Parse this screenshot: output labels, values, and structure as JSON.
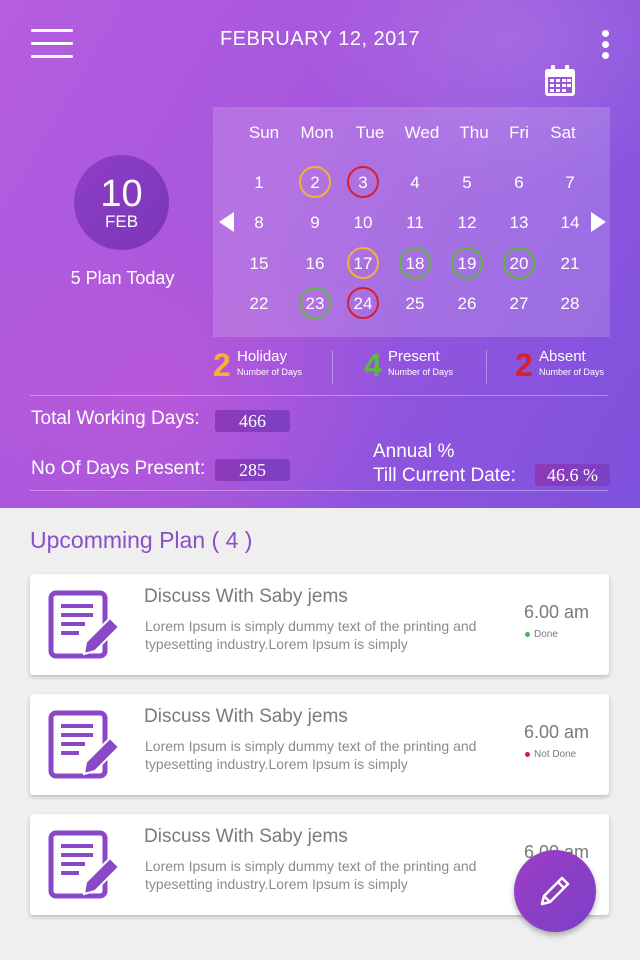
{
  "header": {
    "date_title": "FEBRUARY 12, 2017"
  },
  "selected": {
    "day": "10",
    "month": "FEB",
    "plan_text": "5 Plan Today"
  },
  "calendar": {
    "weekdays": [
      "Sun",
      "Mon",
      "Tue",
      "Wed",
      "Thu",
      "Fri",
      "Sat"
    ],
    "weeks": [
      [
        "1",
        "2",
        "3",
        "4",
        "5",
        "6",
        "7"
      ],
      [
        "8",
        "9",
        "10",
        "11",
        "12",
        "13",
        "14"
      ],
      [
        "15",
        "16",
        "17",
        "18",
        "19",
        "20",
        "21"
      ],
      [
        "22",
        "23",
        "24",
        "25",
        "26",
        "27",
        "28"
      ]
    ],
    "marked": {
      "holiday": [
        "2",
        "17"
      ],
      "present": [
        "18",
        "19",
        "20",
        "23"
      ],
      "absent": [
        "3",
        "24"
      ]
    }
  },
  "legend": [
    {
      "count": "2",
      "label": "Holiday",
      "sub": "Number of Days",
      "color": "#f3b13a"
    },
    {
      "count": "4",
      "label": "Present",
      "sub": "Number of Days",
      "color": "#5cb83e"
    },
    {
      "count": "2",
      "label": "Absent",
      "sub": "Number of Days",
      "color": "#d8202c"
    }
  ],
  "stats": {
    "total_label": "Total Working Days:",
    "total_value": "466",
    "present_label": "No Of Days Present:",
    "present_value": "285",
    "annual_label": "Annual %",
    "till_label": "Till Current Date:",
    "annual_value": "46.6 %"
  },
  "upcoming": {
    "title": "Upcomming Plan ( 4 )",
    "cards": [
      {
        "title": "Discuss With Saby jems",
        "desc": "Lorem Ipsum is simply dummy text of the printing and typesetting industry.Lorem Ipsum is simply",
        "time": "6.00 am",
        "status": "Done",
        "status_color": "#4caf50"
      },
      {
        "title": "Discuss With Saby jems",
        "desc": "Lorem Ipsum is simply dummy text of the printing and typesetting industry.Lorem Ipsum is simply",
        "time": "6.00 am",
        "status": "Not Done",
        "status_color": "#d8202c"
      },
      {
        "title": "Discuss With Saby jems",
        "desc": "Lorem Ipsum is simply dummy text of the printing and typesetting industry.Lorem Ipsum is simply",
        "time": "6.00 am",
        "status": "",
        "status_color": ""
      }
    ]
  },
  "icons": {
    "menu": "hamburger-icon",
    "more": "kebab-menu-icon",
    "calendar": "calendar-icon",
    "card": "document-edit-icon",
    "fab": "pencil-icon"
  },
  "colors": {
    "accent": "#8a4fc9",
    "holiday": "#f3b13a",
    "present": "#5cb83e",
    "absent": "#d8202c"
  }
}
